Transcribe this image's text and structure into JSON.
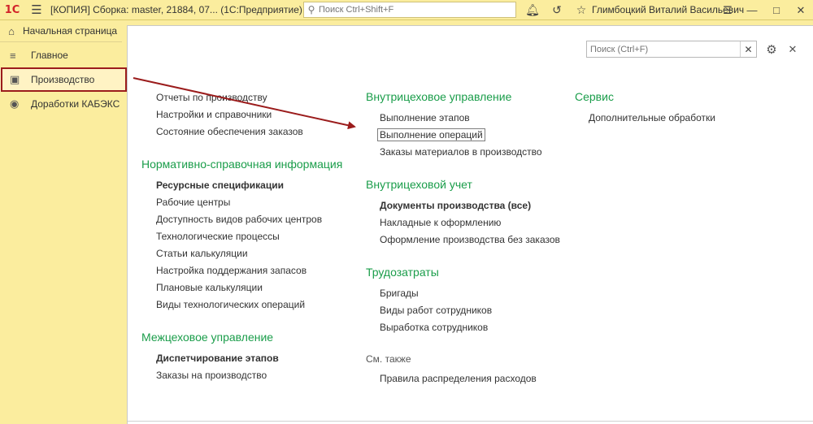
{
  "titlebar": {
    "logo": "1С",
    "title": "[КОПИЯ] Сборка: master, 21884, 07...  (1С:Предприятие)",
    "search_placeholder": "Поиск Ctrl+Shift+F",
    "user": "Глимбоцкий Виталий Васильевич",
    "icons": [
      "bell-icon",
      "history-icon",
      "star-icon"
    ],
    "win_ctrls": [
      "menu",
      "minimize",
      "maximize",
      "close"
    ]
  },
  "home_tab": {
    "label": "Начальная страница",
    "icon": "home-icon"
  },
  "sidebar": {
    "items": [
      {
        "label": "Главное",
        "icon": "list-icon"
      },
      {
        "label": "Производство",
        "icon": "factory-icon"
      },
      {
        "label": "Доработки КАБЭКС",
        "icon": "addon-icon"
      }
    ]
  },
  "panel": {
    "search_placeholder": "Поиск (Ctrl+F)",
    "col1": {
      "top_links": [
        "Отчеты по производству",
        "Настройки и справочники",
        "Состояние обеспечения заказов"
      ],
      "group1": {
        "title": "Нормативно-справочная информация",
        "links": [
          "Ресурсные спецификации",
          "Рабочие центры",
          "Доступность видов рабочих центров",
          "Технологические процессы",
          "Статьи калькуляции",
          "Настройка поддержания запасов",
          "Плановые калькуляции",
          "Виды технологических операций"
        ]
      },
      "group2": {
        "title": "Межцеховое управление",
        "links": [
          "Диспетчирование этапов",
          "Заказы на производство"
        ]
      }
    },
    "col2": {
      "group1": {
        "title": "Внутрицеховое управление",
        "links": [
          "Выполнение этапов",
          "Выполнение операций",
          "Заказы материалов в производство"
        ]
      },
      "group2": {
        "title": "Внутрицеховой учет",
        "links": [
          "Документы производства (все)",
          "Накладные к оформлению",
          "Оформление производства без заказов"
        ]
      },
      "group3": {
        "title": "Трудозатраты",
        "links": [
          "Бригады",
          "Виды работ сотрудников",
          "Выработка сотрудников"
        ]
      },
      "see_also": {
        "title": "См. также",
        "links": [
          "Правила распределения расходов"
        ]
      }
    },
    "col3": {
      "group1": {
        "title": "Сервис",
        "links": [
          "Дополнительные обработки"
        ]
      }
    }
  },
  "colors": {
    "background": "#fbed9e",
    "group_title": "#1a9d4a",
    "highlight": "#9b1c1c"
  }
}
